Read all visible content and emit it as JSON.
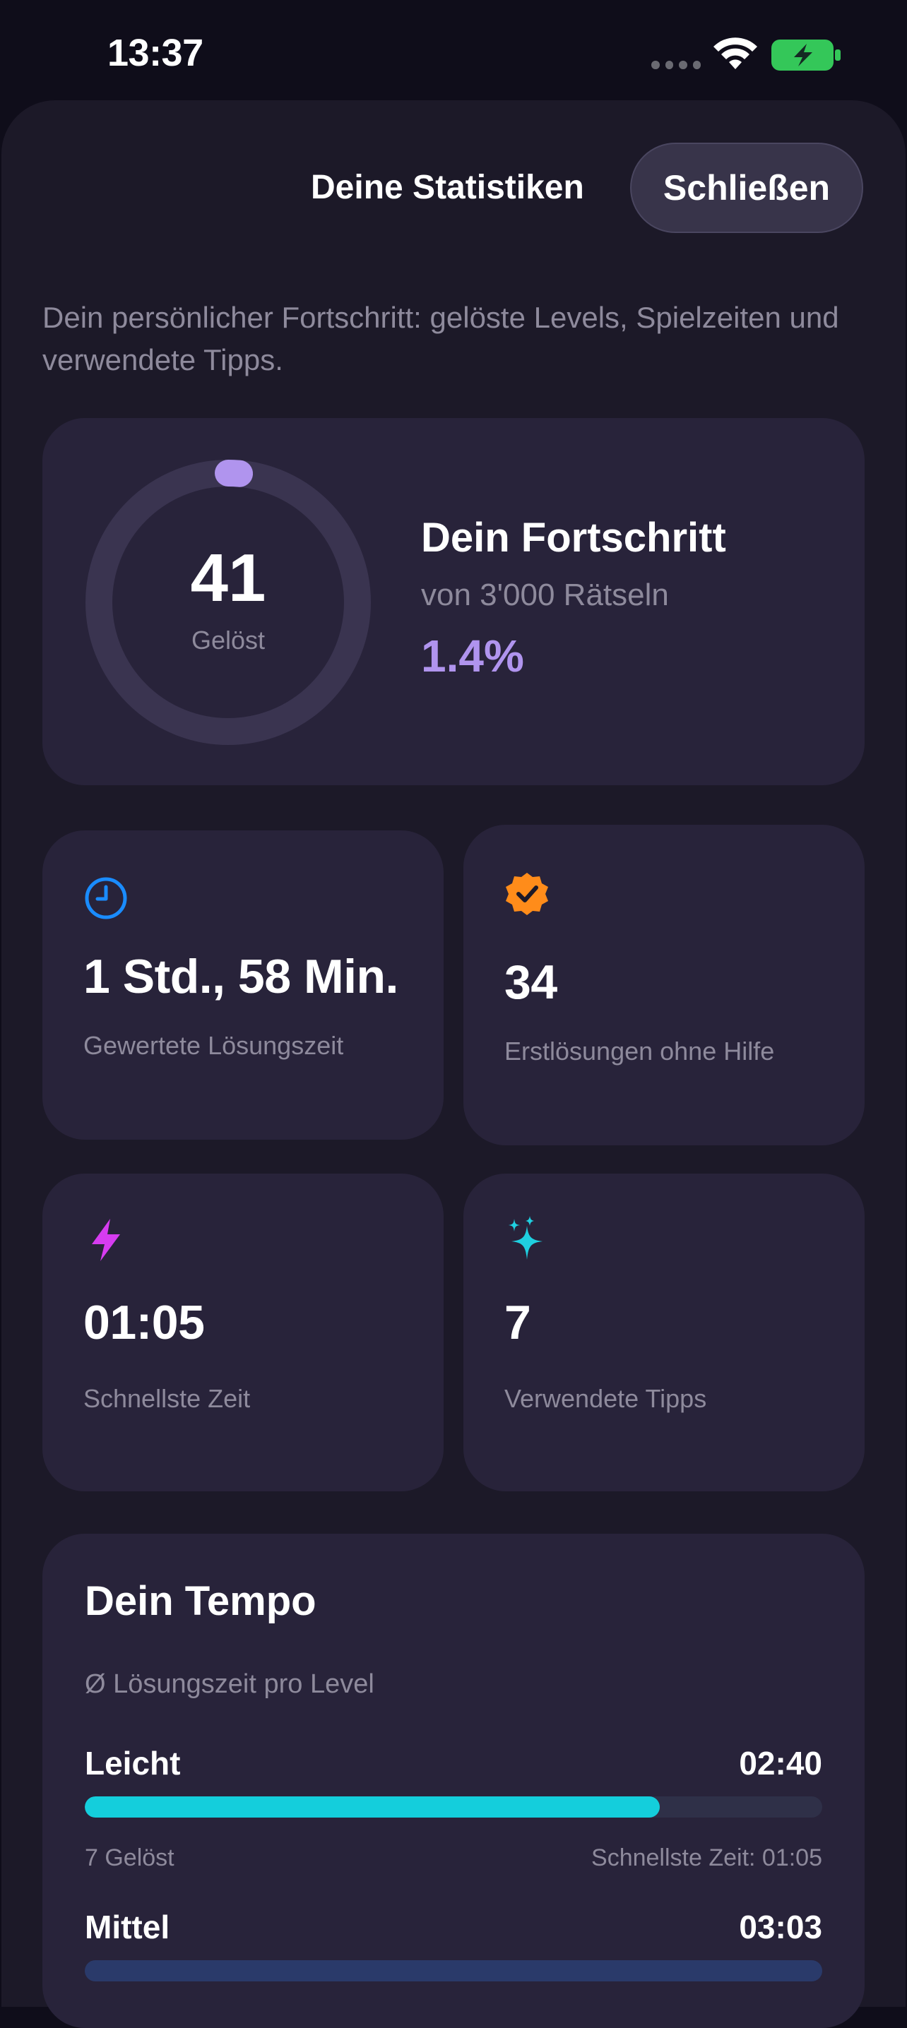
{
  "status_bar": {
    "time": "13:37"
  },
  "header": {
    "title": "Deine Statistiken",
    "close_label": "Schließen"
  },
  "subtitle": "Dein persönlicher Fortschritt: gelöste Levels, Spielzeiten und verwendete Tipps.",
  "progress": {
    "solved": "41",
    "solved_label": "Gelöst",
    "title": "Dein Fortschritt",
    "of_text": "von 3'000 Rätseln",
    "percent": "1.4%",
    "fraction": 0.014,
    "accent": "#b094ee"
  },
  "stats": [
    {
      "icon": "clock-icon",
      "color": "#1a8cff",
      "value": "1 Std., 58 Min.",
      "label": "Gewertete Lösungszeit"
    },
    {
      "icon": "verified-badge-icon",
      "color": "#ff8c1a",
      "value": "34",
      "label": "Erstlösungen ohne Hilfe"
    },
    {
      "icon": "lightning-icon",
      "color": "#d63cf0",
      "value": "01:05",
      "label": "Schnellste Zeit"
    },
    {
      "icon": "sparkles-icon",
      "color": "#1fd0e0",
      "value": "7",
      "label": "Verwendete Tipps"
    }
  ],
  "tempo": {
    "title": "Dein Tempo",
    "subtitle": "Ø Lösungszeit pro Level",
    "rows": [
      {
        "name": "Leicht",
        "time": "02:40",
        "fraction": 0.78,
        "solved": "7 Gelöst",
        "fastest": "Schnellste Zeit: 01:05"
      },
      {
        "name": "Mittel",
        "time": "03:03"
      }
    ]
  }
}
